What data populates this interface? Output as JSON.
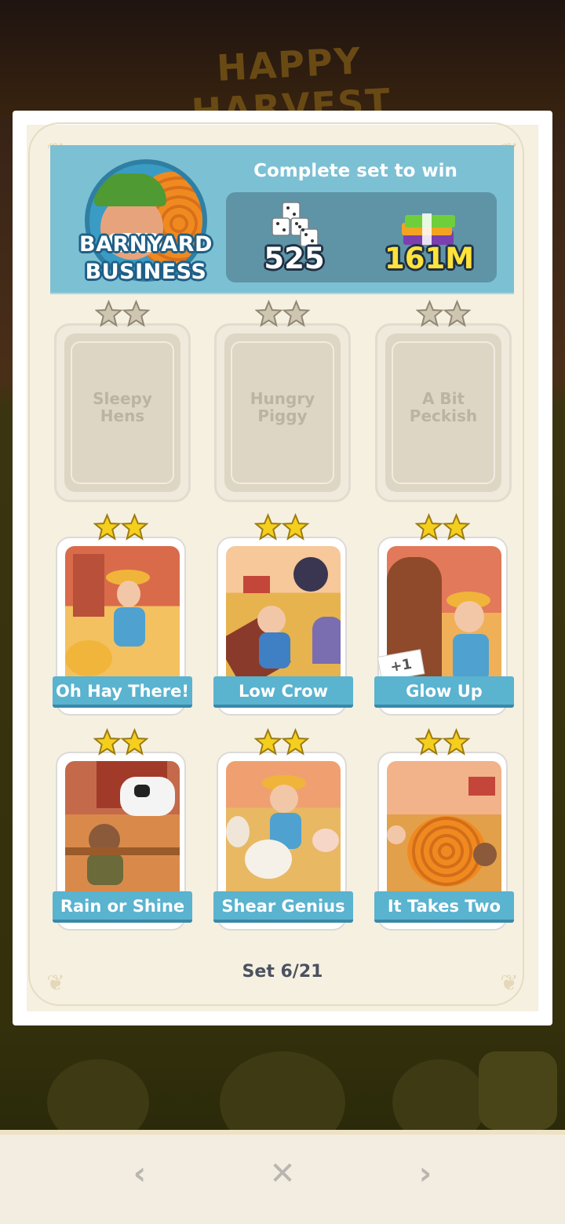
{
  "background": {
    "banner_text": "HAPPY HARVEST"
  },
  "set": {
    "title_line1": "BARNYARD",
    "title_line2": "BUSINESS",
    "reward_caption": "Complete set to win",
    "reward_dice": "525",
    "reward_cash": "161M",
    "progress": "Set 6/21"
  },
  "stickers": [
    {
      "name": "Sleepy Hens",
      "line1": "Sleepy",
      "line2": "Hens",
      "stars": 2,
      "collected": false
    },
    {
      "name": "Hungry Piggy",
      "line1": "Hungry",
      "line2": "Piggy",
      "stars": 2,
      "collected": false
    },
    {
      "name": "A Bit Peckish",
      "line1": "A Bit",
      "line2": "Peckish",
      "stars": 2,
      "collected": false
    },
    {
      "name": "Oh Hay There!",
      "stars": 2,
      "collected": true
    },
    {
      "name": "Low Crow",
      "stars": 2,
      "collected": true
    },
    {
      "name": "Glow Up",
      "stars": 2,
      "collected": true,
      "badge": "+1"
    },
    {
      "name": "Rain or Shine",
      "stars": 2,
      "collected": true
    },
    {
      "name": "Shear Genius",
      "stars": 2,
      "collected": true
    },
    {
      "name": "It Takes Two",
      "stars": 2,
      "collected": true
    }
  ],
  "nav": {
    "prev_icon": "‹",
    "close_icon": "✕",
    "next_icon": "›"
  },
  "icons": {
    "dice": "dice-stack-icon",
    "cash": "cash-stack-icon",
    "star": "star-icon"
  },
  "colors": {
    "header": "#7cc0d4",
    "label": "#5ab3cf",
    "star_gold": "#f5cf1e",
    "star_grey": "#cfc6b2"
  }
}
